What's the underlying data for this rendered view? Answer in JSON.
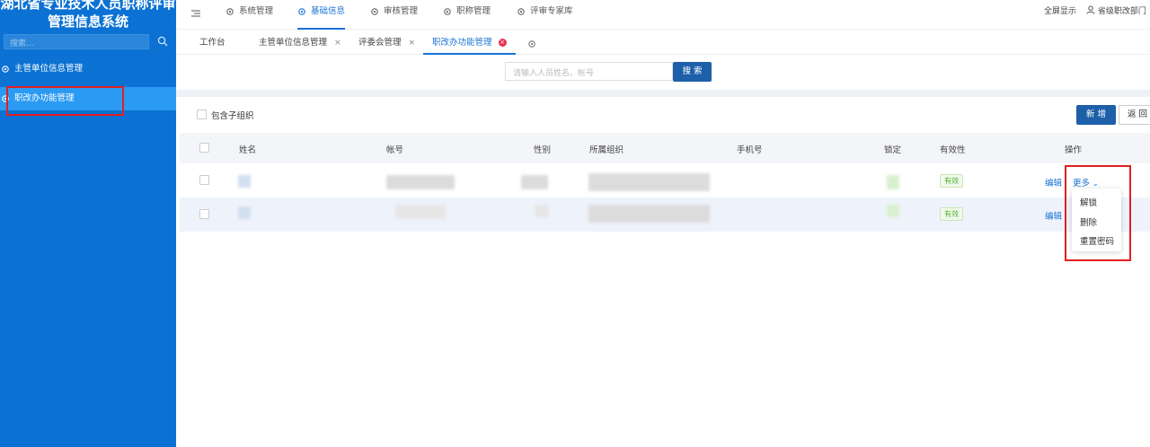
{
  "sidebar": {
    "system_title": "湖北省专业技术人员职称评审管理信息系统",
    "search_placeholder": "搜索...",
    "items": [
      {
        "label": "主管单位信息管理",
        "icon": "gear-icon",
        "active": false
      },
      {
        "label": "职改办功能管理",
        "icon": "gear-icon",
        "active": true
      }
    ]
  },
  "topnav": {
    "menu_icon": "hamburger-icon",
    "items": [
      {
        "label": "系统管理",
        "icon": "gear-icon",
        "active": false
      },
      {
        "label": "基础信息",
        "icon": "gear-icon",
        "active": true
      },
      {
        "label": "审核管理",
        "icon": "gear-icon",
        "active": false
      },
      {
        "label": "职称管理",
        "icon": "gear-icon",
        "active": false
      },
      {
        "label": "评审专家库",
        "icon": "gear-icon",
        "active": false
      }
    ],
    "fullscreen": "全屏显示",
    "user": "省级职改部门"
  },
  "tabs": [
    {
      "label": "工作台",
      "closable": false,
      "active": false
    },
    {
      "label": "主管单位信息管理",
      "closable": true,
      "active": false
    },
    {
      "label": "评委会管理",
      "closable": true,
      "active": false
    },
    {
      "label": "职改办功能管理",
      "closable": true,
      "active": true
    }
  ],
  "search": {
    "placeholder": "请输入人员姓名、帐号",
    "button": "搜 索"
  },
  "toolbar": {
    "include_sub_org": "包含子组织",
    "add_button": "新 增",
    "back_button": "返 回"
  },
  "table": {
    "columns": [
      "姓名",
      "帐号",
      "性别",
      "所属组织",
      "手机号",
      "锁定",
      "有效性",
      "操作"
    ],
    "rows": [
      {
        "validity": "有效",
        "edit": "编辑",
        "more": "更多"
      },
      {
        "validity": "有效",
        "edit": "编辑"
      }
    ],
    "more_menu": [
      "解锁",
      "删除",
      "重置密码"
    ]
  },
  "colors": {
    "sidebar_bg": "#0b72d4",
    "primary": "#1d5fa8",
    "accent": "#1a73d4",
    "valid_green": "#52b230",
    "highlight_red": "#e02020"
  }
}
